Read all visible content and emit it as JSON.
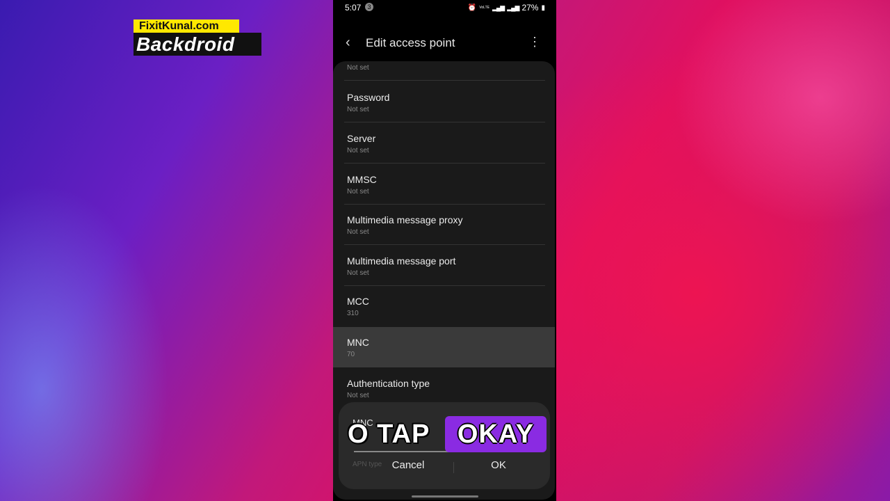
{
  "brand": {
    "site": "FixitKunal.com",
    "name": "Backdroid"
  },
  "statusbar": {
    "time": "5:07",
    "badge": "3",
    "network": "VoLTE",
    "battery": "27%"
  },
  "appbar": {
    "title": "Edit access point"
  },
  "settings": {
    "items": [
      {
        "name": "",
        "value": "Not set"
      },
      {
        "name": "Password",
        "value": "Not set"
      },
      {
        "name": "Server",
        "value": "Not set"
      },
      {
        "name": "MMSC",
        "value": "Not set"
      },
      {
        "name": "Multimedia message proxy",
        "value": "Not set"
      },
      {
        "name": "Multimedia message port",
        "value": "Not set"
      },
      {
        "name": "MCC",
        "value": "310"
      },
      {
        "name": "MNC",
        "value": "70"
      },
      {
        "name": "Authentication type",
        "value": "Not set"
      }
    ],
    "hidden_behind_dialog": "APN type"
  },
  "dialog": {
    "title": "MNC",
    "cancel": "Cancel",
    "ok": "OK"
  },
  "caption": {
    "text": "O TAP",
    "highlight": "OKAY",
    "highlight_color": "#8a2be2"
  }
}
